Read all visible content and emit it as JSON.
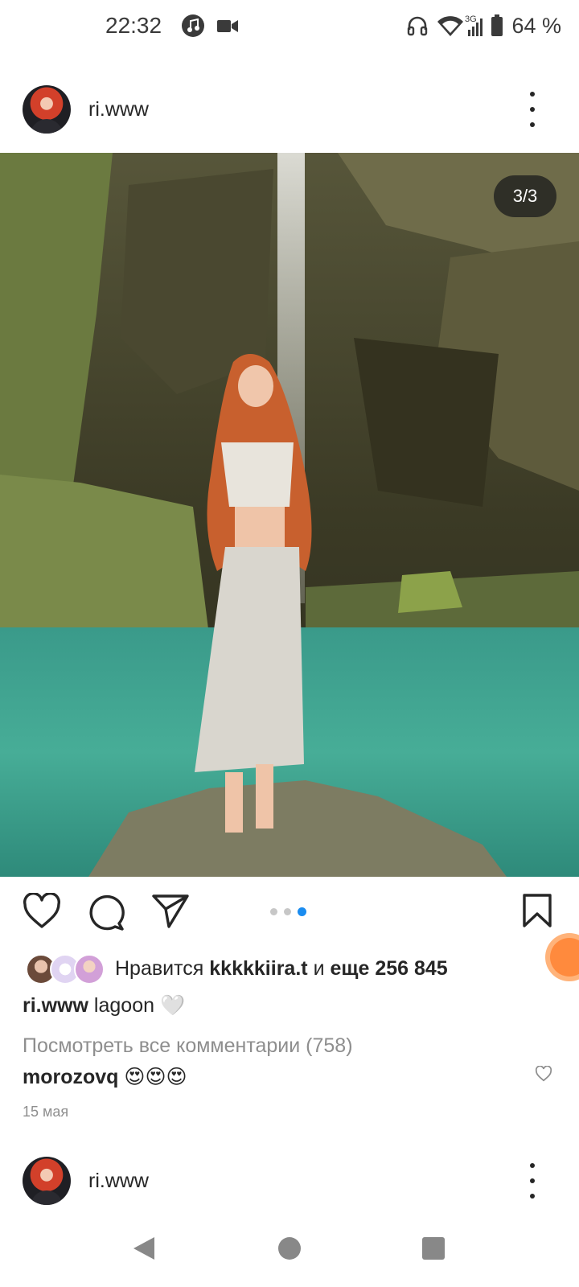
{
  "status_bar": {
    "time": "22:32",
    "network": "3G",
    "battery": "64 %",
    "icons": [
      "music-icon",
      "video-camera-icon",
      "headphones-icon",
      "wifi-icon",
      "signal-icon",
      "battery-icon"
    ]
  },
  "post": {
    "username": "ri.www",
    "image_counter": "3/3",
    "carousel": {
      "total": 3,
      "active": 3
    },
    "likes": {
      "prefix": "Нравится",
      "liked_by": "kkkkkiira.t",
      "connector": "и",
      "others": "еще 256 845"
    },
    "caption": {
      "username": "ri.www",
      "text": "lagoon 🤍"
    },
    "view_comments": "Посмотреть все комментарии (758)",
    "top_comment": {
      "username": "morozovq",
      "text": "😍😍😍"
    },
    "date": "15 мая"
  },
  "next_post": {
    "username": "ri.www"
  },
  "colors": {
    "text": "#262626",
    "secondary_text": "#8e8e8e",
    "carousel_active": "#1a8cf0",
    "carousel_inactive": "#c7c7c7",
    "water": "#3fa592",
    "floating_button": "#ff8a3d"
  }
}
